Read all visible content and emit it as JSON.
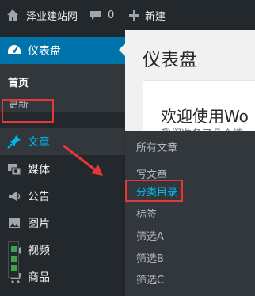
{
  "admin_bar": {
    "site_name": "泽业建站网",
    "comment_count": "0",
    "new_label": "新建",
    "icons": [
      "home-icon",
      "comment-icon",
      "plus-icon"
    ]
  },
  "sidebar": {
    "dashboard": {
      "label": "仪表盘",
      "icon": "dashboard-icon"
    },
    "submenu": {
      "home": "首页",
      "update": "更新"
    },
    "items": [
      {
        "label": "文章",
        "icon": "pin-icon",
        "active": true
      },
      {
        "label": "媒体",
        "icon": "media-icon"
      },
      {
        "label": "公告",
        "icon": "megaphone-icon"
      },
      {
        "label": "图片",
        "icon": "image-icon"
      },
      {
        "label": "视频",
        "icon": "video-icon"
      },
      {
        "label": "商品",
        "icon": "cart-icon"
      }
    ]
  },
  "flyout": {
    "items": [
      "所有文章",
      "写文章",
      "分类目录",
      "标签",
      "筛选A",
      "筛选B",
      "筛选C"
    ],
    "highlighted": "分类目录"
  },
  "main": {
    "page_title": "仪表盘",
    "welcome_title": "欢迎使用Wo",
    "welcome_sub": "我们准备了几个链"
  },
  "colors": {
    "admin_bg": "#23282d",
    "active_blue": "#0073aa",
    "link_blue": "#00b9eb",
    "annotation_red": "#e2383a"
  }
}
